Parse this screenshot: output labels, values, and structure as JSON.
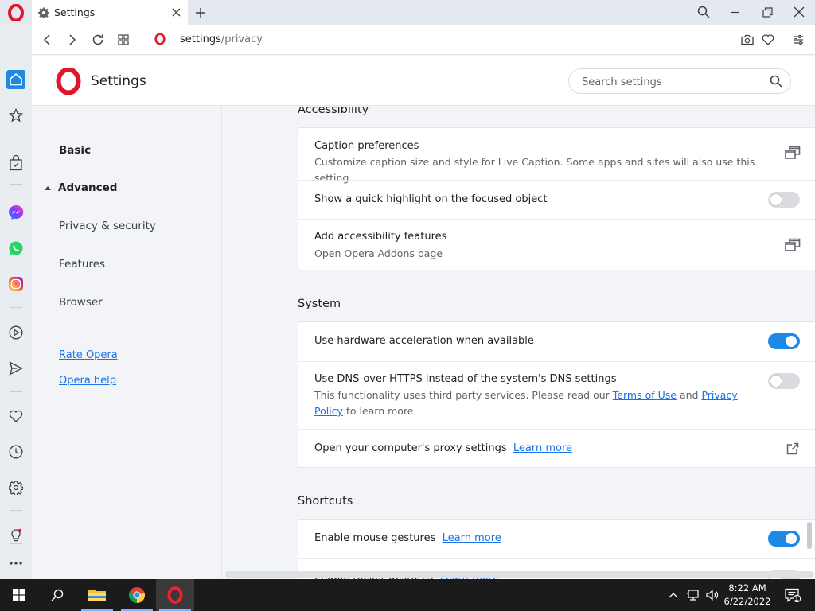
{
  "browser": {
    "tab_title": "Settings",
    "url_host": "settings",
    "url_path": "/privacy"
  },
  "header": {
    "title": "Settings",
    "search_placeholder": "Search settings"
  },
  "leftnav": {
    "basic": "Basic",
    "advanced": "Advanced",
    "items": [
      "Privacy & security",
      "Features",
      "Browser"
    ],
    "rate": "Rate Opera",
    "help": "Opera help"
  },
  "sections": {
    "accessibility": {
      "title": "Accessibility",
      "caption_title": "Caption preferences",
      "caption_sub": "Customize caption size and style for Live Caption. Some apps and sites will also use this setting.",
      "highlight_title": "Show a quick highlight on the focused object",
      "highlight_on": false,
      "addons_title": "Add accessibility features",
      "addons_sub": "Open Opera Addons page"
    },
    "system": {
      "title": "System",
      "hw_title": "Use hardware acceleration when available",
      "hw_on": true,
      "dns_title": "Use DNS-over-HTTPS instead of the system's DNS settings",
      "dns_sub_a": "This functionality uses third party services. Please read our",
      "dns_terms": "Terms of Use",
      "dns_and": "and",
      "dns_privacy": "Privacy Policy",
      "dns_sub_b": "to learn more.",
      "dns_on": false,
      "proxy_title": "Open your computer's proxy settings",
      "proxy_link": "Learn more"
    },
    "shortcuts": {
      "title": "Shortcuts",
      "mouse_title": "Enable mouse gestures",
      "mouse_link": "Learn more",
      "mouse_on": true,
      "rocker_title": "Enable rocker gestures",
      "rocker_link": "Learn more",
      "rocker_on": false
    }
  },
  "taskbar": {
    "time": "8:22 AM",
    "date": "6/22/2022",
    "notification_count": "1"
  },
  "colors": {
    "opera_red": "#e0162b",
    "accent_blue": "#1e88e5",
    "link_blue": "#1a73e8"
  }
}
